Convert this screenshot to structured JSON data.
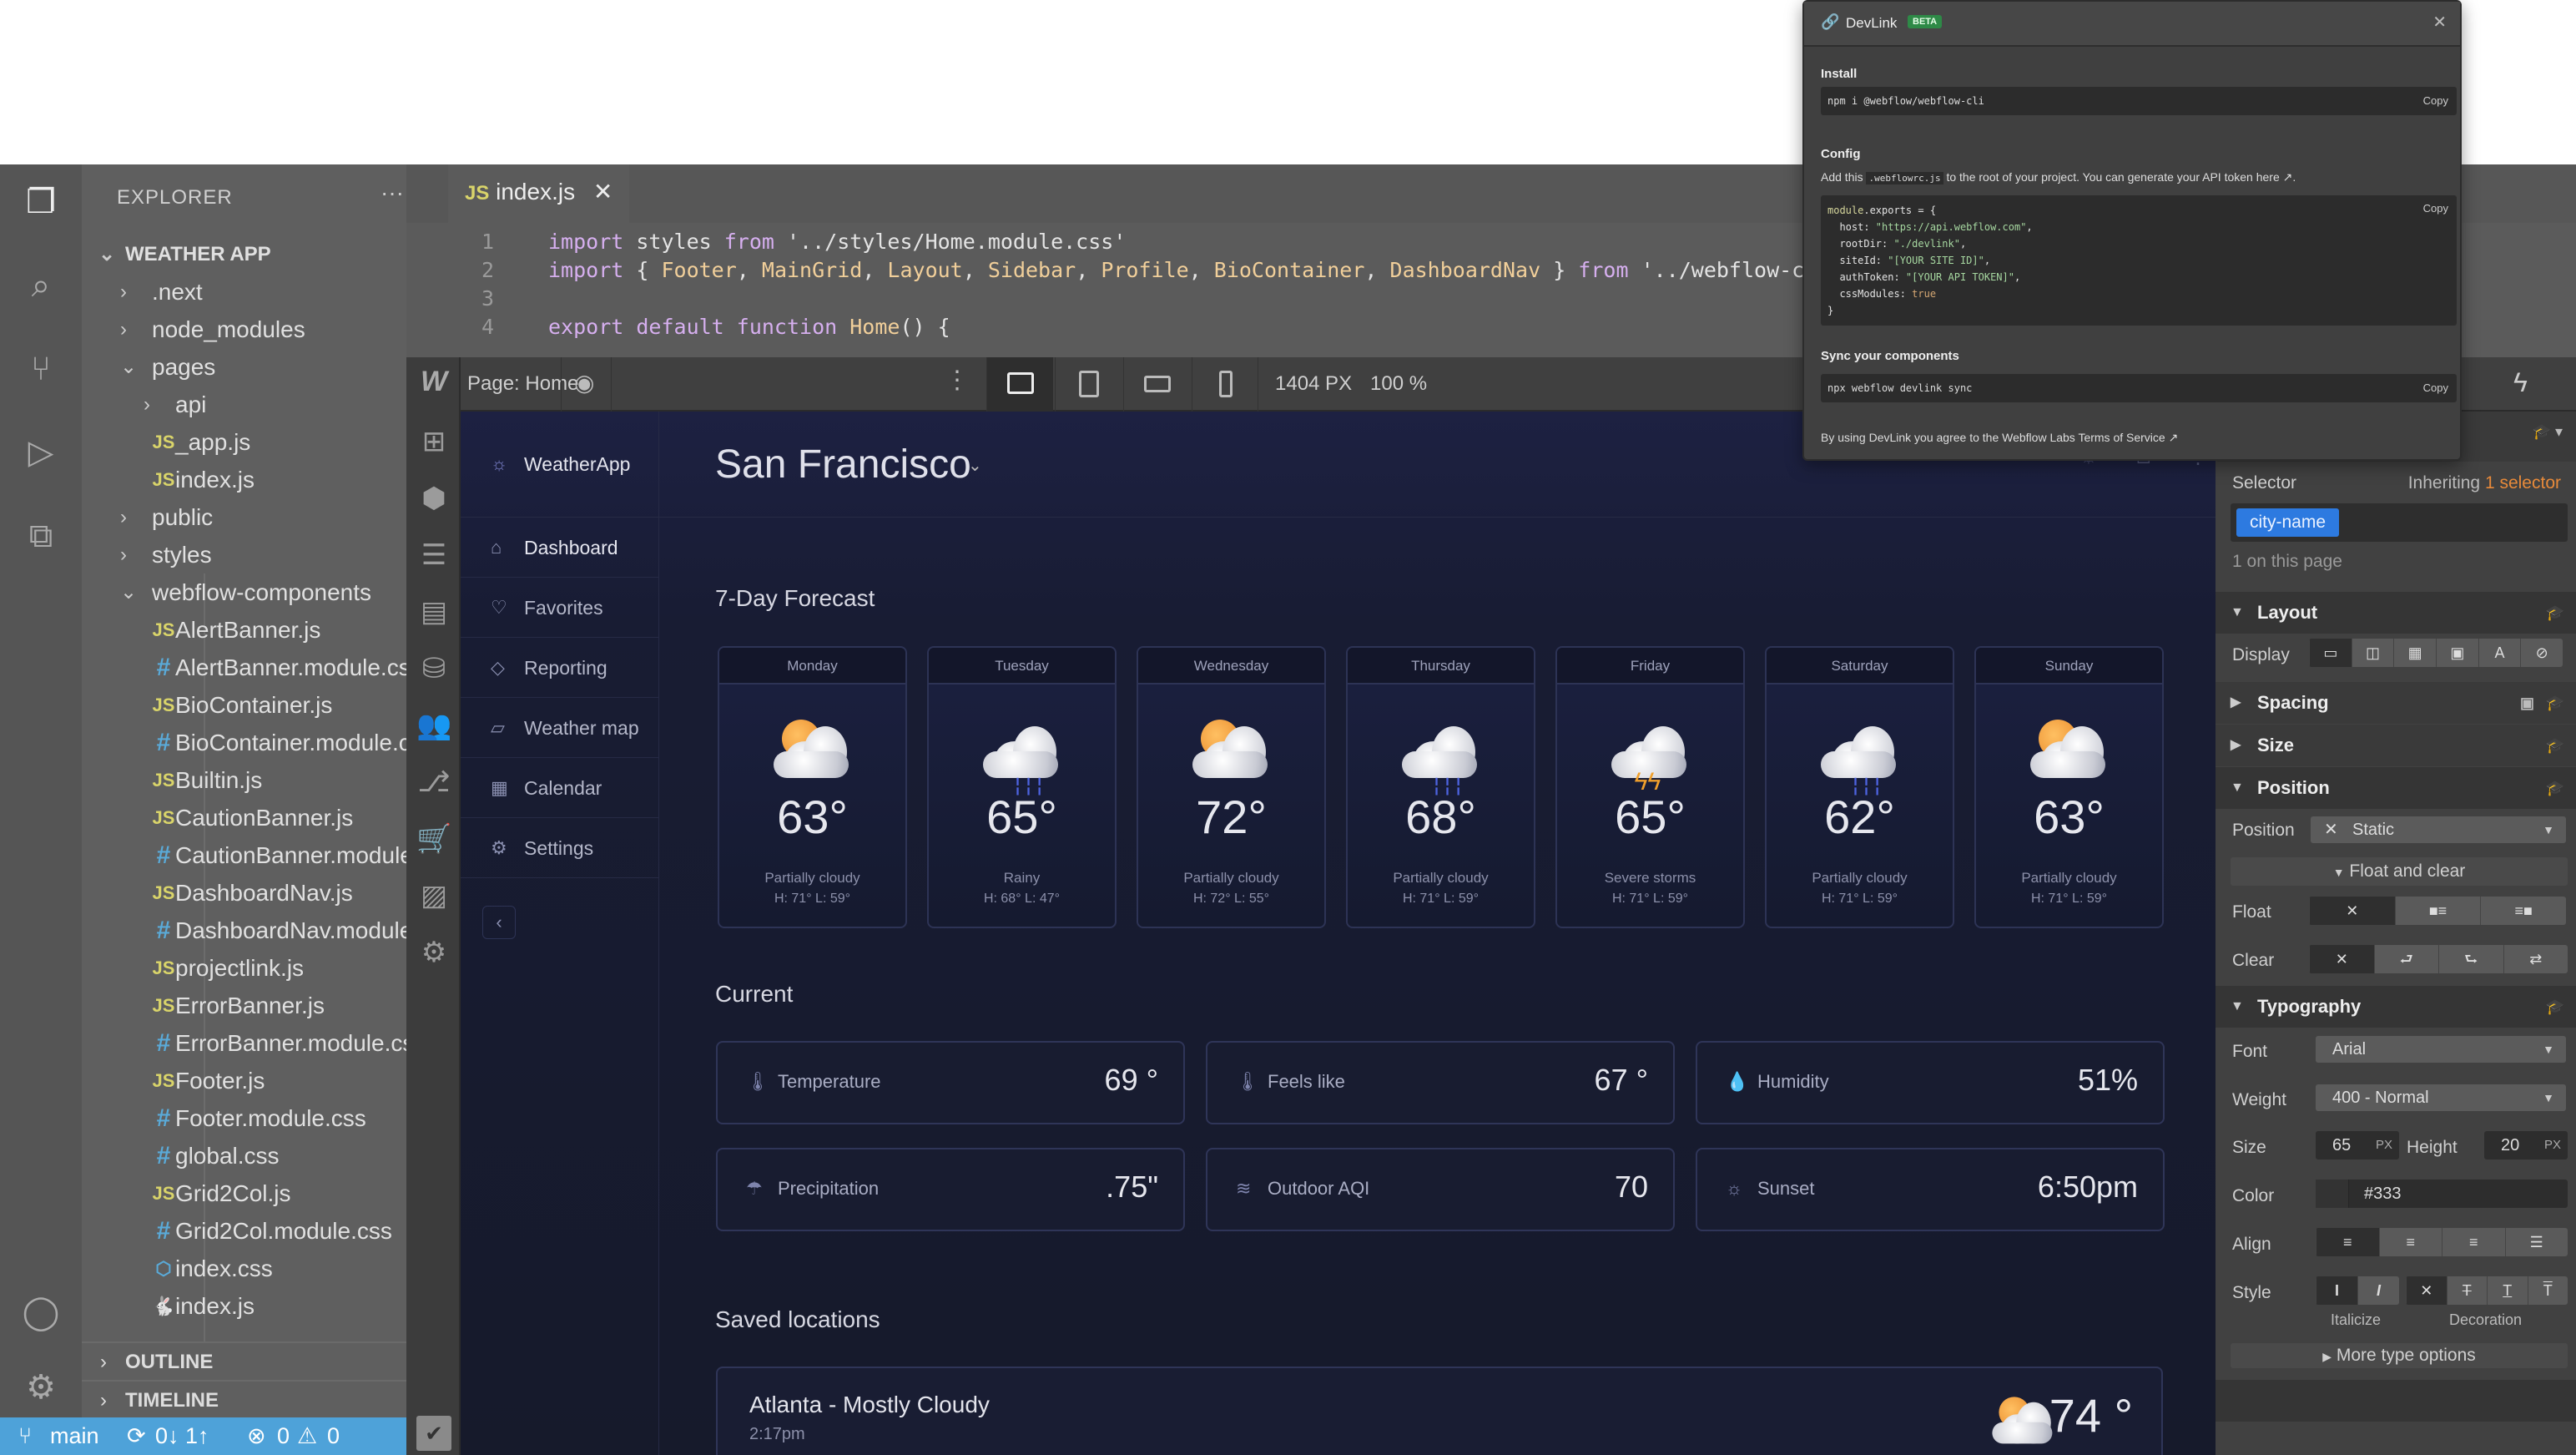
{
  "vscode": {
    "explorer_title": "EXPLORER",
    "root": "WEATHER APP",
    "files": [
      {
        "name": ".next",
        "type": "folder",
        "level": 1,
        "open": false
      },
      {
        "name": "node_modules",
        "type": "folder",
        "level": 1,
        "open": false
      },
      {
        "name": "pages",
        "type": "folder",
        "level": 1,
        "open": true
      },
      {
        "name": "api",
        "type": "folder",
        "level": 2,
        "open": false
      },
      {
        "name": "_app.js",
        "type": "js",
        "level": 2
      },
      {
        "name": "index.js",
        "type": "js",
        "level": 2
      },
      {
        "name": "public",
        "type": "folder",
        "level": 1,
        "open": false
      },
      {
        "name": "styles",
        "type": "folder",
        "level": 1,
        "open": false
      },
      {
        "name": "webflow-components",
        "type": "folder",
        "level": 1,
        "open": true
      },
      {
        "name": "AlertBanner.js",
        "type": "js",
        "level": 2
      },
      {
        "name": "AlertBanner.module.css",
        "type": "css",
        "level": 2
      },
      {
        "name": "BioContainer.js",
        "type": "js",
        "level": 2
      },
      {
        "name": "BioContainer.module.css",
        "type": "css",
        "level": 2
      },
      {
        "name": "Builtin.js",
        "type": "js",
        "level": 2
      },
      {
        "name": "CautionBanner.js",
        "type": "js",
        "level": 2
      },
      {
        "name": "CautionBanner.module.css",
        "type": "css",
        "level": 2
      },
      {
        "name": "DashboardNav.js",
        "type": "js",
        "level": 2
      },
      {
        "name": "DashboardNav.module.css",
        "type": "css",
        "level": 2
      },
      {
        "name": "projectlink.js",
        "type": "js",
        "level": 2
      },
      {
        "name": "ErrorBanner.js",
        "type": "js",
        "level": 2
      },
      {
        "name": "ErrorBanner.module.css",
        "type": "css",
        "level": 2
      },
      {
        "name": "Footer.js",
        "type": "js",
        "level": 2
      },
      {
        "name": "Footer.module.css",
        "type": "css",
        "level": 2
      },
      {
        "name": "global.css",
        "type": "css",
        "level": 2
      },
      {
        "name": "Grid2Col.js",
        "type": "js",
        "level": 2
      },
      {
        "name": "Grid2Col.module.css",
        "type": "css",
        "level": 2
      },
      {
        "name": "index.css",
        "type": "hex",
        "level": 2
      },
      {
        "name": "index.js",
        "type": "rabbit",
        "level": 2
      }
    ],
    "outline": "OUTLINE",
    "timeline": "TIMELINE",
    "status": {
      "branch": "main",
      "sync": "0↓ 1↑",
      "errors": "0",
      "warnings": "0"
    },
    "tab": {
      "icon": "JS",
      "name": "index.js"
    },
    "code": [
      {
        "n": "1",
        "tokens": [
          [
            "import",
            "kw"
          ],
          [
            " styles ",
            "plain"
          ],
          [
            "from",
            "kw"
          ],
          [
            " '../styles/Home.module.css'",
            "str"
          ]
        ]
      },
      {
        "n": "2",
        "tokens": [
          [
            "import",
            "kw"
          ],
          [
            " { ",
            "plain"
          ],
          [
            "Footer",
            "cls"
          ],
          [
            ", ",
            "plain"
          ],
          [
            "MainGrid",
            "cls"
          ],
          [
            ", ",
            "plain"
          ],
          [
            "Layout",
            "cls"
          ],
          [
            ", ",
            "plain"
          ],
          [
            "Sidebar",
            "cls"
          ],
          [
            ", ",
            "plain"
          ],
          [
            "Profile",
            "cls"
          ],
          [
            ", ",
            "plain"
          ],
          [
            "BioContainer",
            "cls"
          ],
          [
            ", ",
            "plain"
          ],
          [
            "DashboardNav",
            "cls"
          ],
          [
            " } ",
            "plain"
          ],
          [
            "from",
            "kw"
          ],
          [
            " '../webflow-com",
            "str"
          ]
        ]
      },
      {
        "n": "3",
        "tokens": []
      },
      {
        "n": "4",
        "tokens": [
          [
            "export default function",
            "kw"
          ],
          [
            " ",
            "plain"
          ],
          [
            "Home",
            "cls"
          ],
          [
            "() {",
            "plain"
          ]
        ]
      }
    ]
  },
  "webflow": {
    "page_label": "Page: Home",
    "width": "1404 PX",
    "zoom": "100 %",
    "devices": [
      "desktop",
      "tablet",
      "mobile-landscape",
      "mobile-portrait"
    ],
    "active_device": "desktop"
  },
  "weather_app": {
    "brand": "WeatherApp",
    "city": "San Francisco",
    "nav": [
      {
        "label": "Dashboard",
        "icon": "home",
        "active": true
      },
      {
        "label": "Favorites",
        "icon": "heart"
      },
      {
        "label": "Reporting",
        "icon": "diamond"
      },
      {
        "label": "Weather map",
        "icon": "map"
      },
      {
        "label": "Calendar",
        "icon": "calendar"
      },
      {
        "label": "Settings",
        "icon": "gear"
      }
    ],
    "forecast_title": "7-Day Forecast",
    "forecast": [
      {
        "day": "Monday",
        "temp": "63",
        "cond": "Partially cloudy",
        "hl": "H: 71°   L: 59°",
        "icon": "partly"
      },
      {
        "day": "Tuesday",
        "temp": "65",
        "cond": "Rainy",
        "hl": "H: 68°   L: 47°",
        "icon": "rain"
      },
      {
        "day": "Wednesday",
        "temp": "72",
        "cond": "Partially cloudy",
        "hl": "H: 72°   L: 55°",
        "icon": "partly"
      },
      {
        "day": "Thursday",
        "temp": "68",
        "cond": "Partially cloudy",
        "hl": "H: 71°   L: 59°",
        "icon": "rain"
      },
      {
        "day": "Friday",
        "temp": "65",
        "cond": "Severe storms",
        "hl": "H: 71°   L: 59°",
        "icon": "storm"
      },
      {
        "day": "Saturday",
        "temp": "62",
        "cond": "Partially cloudy",
        "hl": "H: 71°   L: 59°",
        "icon": "rain"
      },
      {
        "day": "Sunday",
        "temp": "63",
        "cond": "Partially cloudy",
        "hl": "H: 71°   L: 59°",
        "icon": "partly"
      }
    ],
    "current_title": "Current",
    "current": [
      {
        "label": "Temperature",
        "value": "69 °",
        "icon": "thermometer"
      },
      {
        "label": "Feels like",
        "value": "67 °",
        "icon": "thermometer"
      },
      {
        "label": "Humidity",
        "value": "51%",
        "icon": "droplets"
      },
      {
        "label": "Precipitation",
        "value": ".75\"",
        "icon": "rain-cloud"
      },
      {
        "label": "Outdoor AQI",
        "value": "70",
        "icon": "wind"
      },
      {
        "label": "Sunset",
        "value": "6:50pm",
        "icon": "sunset"
      }
    ],
    "saved_title": "Saved locations",
    "saved": [
      {
        "name": "Atlanta - Mostly Cloudy",
        "time": "2:17pm",
        "temp": "74 °"
      }
    ]
  },
  "style_panel": {
    "selector_label": "Selector",
    "inheriting": "Inheriting",
    "inheriting_count": "1 selector",
    "selector_chip": "city-name",
    "on_page": "1 on this page",
    "sections": {
      "layout": "Layout",
      "spacing": "Spacing",
      "size": "Size",
      "position": "Position",
      "typography": "Typography"
    },
    "display_label": "Display",
    "position_label": "Position",
    "position_value": "Static",
    "float_and_clear": "Float and clear",
    "float_label": "Float",
    "clear_label": "Clear",
    "font_label": "Font",
    "font_value": "Arial",
    "weight_label": "Weight",
    "weight_value": "400 - Normal",
    "size_label": "Size",
    "size_value": "65",
    "height_label": "Height",
    "height_value": "20",
    "unit": "PX",
    "color_label": "Color",
    "color_value": "#333",
    "align_label": "Align",
    "style_label": "Style",
    "italicize": "Italicize",
    "decoration": "Decoration",
    "more_type": "More type options"
  },
  "devlink": {
    "title": "DevLink",
    "badge": "BETA",
    "install_title": "Install",
    "install_cmd": "npm i @webflow/webflow-cli",
    "copy": "Copy",
    "config_title": "Config",
    "config_text_1": "Add this",
    "config_file": ".webflowrc.js",
    "config_text_2": "to the root of your project. You can generate your API token here ↗.",
    "config_code": [
      [
        [
          "module",
          "mod"
        ],
        [
          ".exports = {",
          "plain"
        ]
      ],
      [
        [
          "  host: ",
          "plain"
        ],
        [
          "\"https://api.webflow.com\"",
          "green"
        ],
        [
          ",",
          "plain"
        ]
      ],
      [
        [
          "  rootDir: ",
          "plain"
        ],
        [
          "\"./devlink\"",
          "green"
        ],
        [
          ",",
          "plain"
        ]
      ],
      [
        [
          "  siteId: ",
          "plain"
        ],
        [
          "\"[YOUR SITE ID]\"",
          "green"
        ],
        [
          ",",
          "plain"
        ]
      ],
      [
        [
          "  authToken: ",
          "plain"
        ],
        [
          "\"[YOUR API TOKEN]\"",
          "green"
        ],
        [
          ",",
          "plain"
        ]
      ],
      [
        [
          "  cssModules: ",
          "plain"
        ],
        [
          "true",
          "bool"
        ]
      ],
      [
        [
          "}",
          "plain"
        ]
      ]
    ],
    "sync_title": "Sync your components",
    "sync_cmd": "npx webflow devlink sync",
    "terms": "By using DevLink you agree to the Webflow Labs Terms of Service ↗"
  },
  "colors": {
    "accent_blue": "#2d7ae0",
    "status_bar": "#4ea2d9",
    "beta_green": "#2e8a47",
    "selector_orange": "#e88a3a"
  }
}
